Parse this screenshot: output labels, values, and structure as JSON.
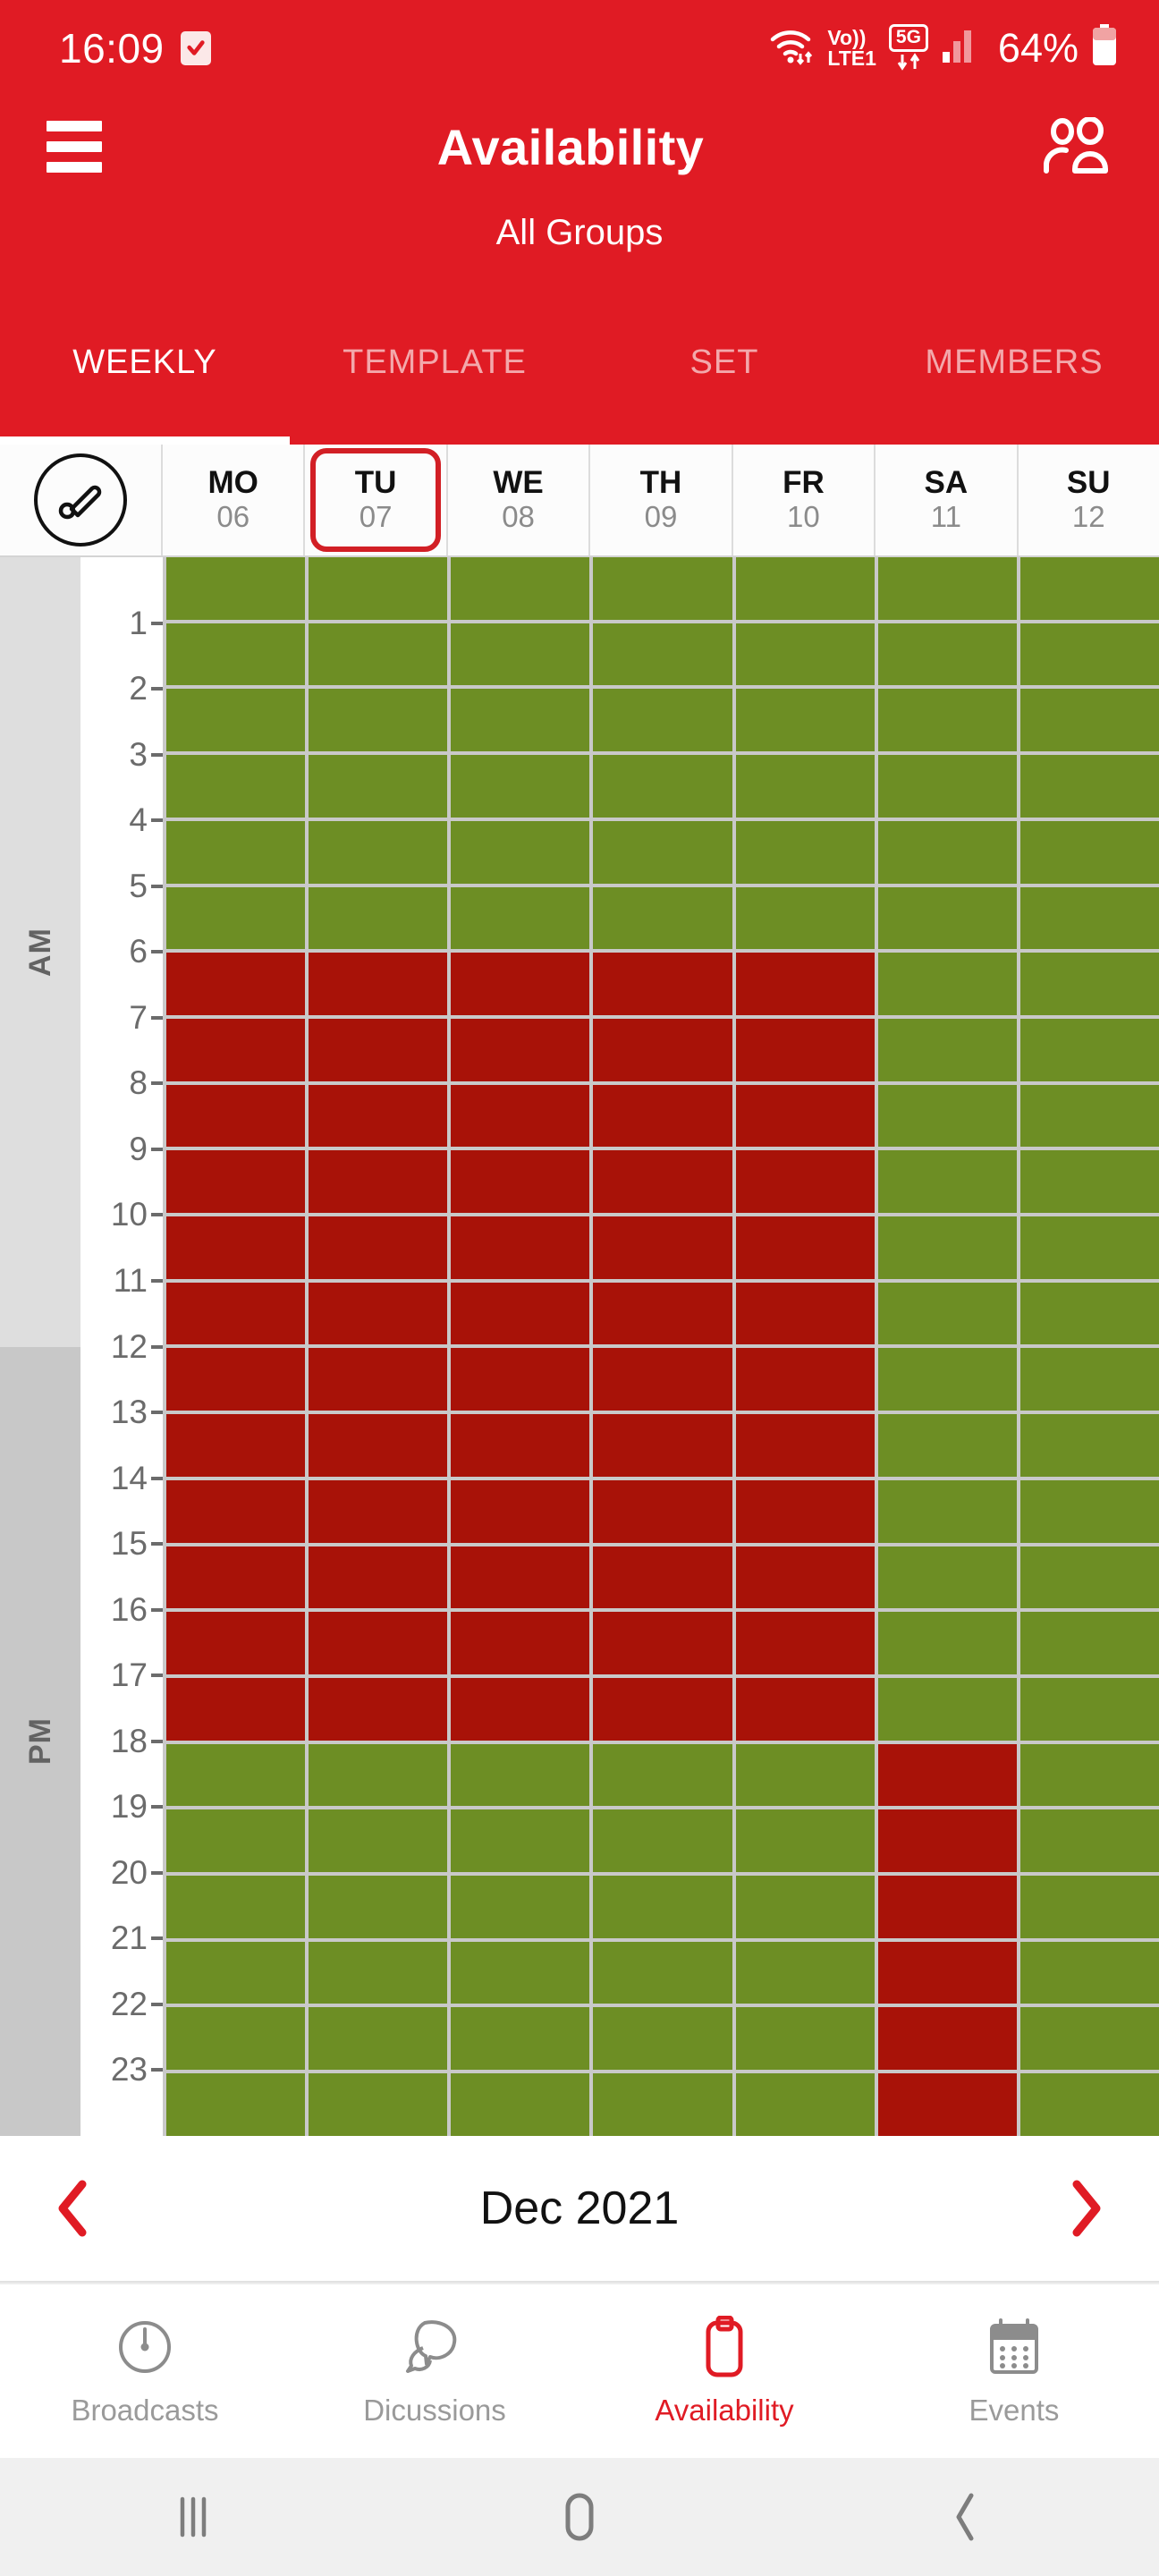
{
  "status_bar": {
    "time": "16:09",
    "checkbox_icon": "checkbox-checked-icon",
    "wifi_icon": "wifi-icon",
    "volte_line1": "Vo))",
    "volte_line2": "LTE1",
    "network_5g": "5G",
    "signal_icon": "signal-bars-icon",
    "battery_percent": "64%",
    "battery_icon": "battery-icon"
  },
  "header": {
    "menu_icon": "hamburger-menu-icon",
    "title": "Availability",
    "members_icon": "people-group-icon",
    "subtitle": "All Groups",
    "brand_red": "#E01B24"
  },
  "tabs": [
    {
      "label": "WEEKLY",
      "active": true
    },
    {
      "label": "TEMPLATE",
      "active": false
    },
    {
      "label": "SET",
      "active": false
    },
    {
      "label": "MEMBERS",
      "active": false
    }
  ],
  "day_header": {
    "brush_icon": "paintbrush-icon",
    "days": [
      {
        "dow": "MO",
        "num": "06",
        "selected": false
      },
      {
        "dow": "TU",
        "num": "07",
        "selected": true
      },
      {
        "dow": "WE",
        "num": "08",
        "selected": false
      },
      {
        "dow": "TH",
        "num": "09",
        "selected": false
      },
      {
        "dow": "FR",
        "num": "10",
        "selected": false
      },
      {
        "dow": "SA",
        "num": "11",
        "selected": false
      },
      {
        "dow": "SU",
        "num": "12",
        "selected": false
      }
    ]
  },
  "schedule": {
    "am_label": "AM",
    "pm_label": "PM",
    "hour_ticks": [
      "1",
      "2",
      "3",
      "4",
      "5",
      "6",
      "7",
      "8",
      "9",
      "10",
      "11",
      "12",
      "13",
      "14",
      "15",
      "16",
      "17",
      "18",
      "19",
      "20",
      "21",
      "22",
      "23"
    ],
    "legend": {
      "free_color": "#6D8E24",
      "busy_color": "#A81208"
    },
    "columns": [
      {
        "day": "MO",
        "hours": [
          "free",
          "free",
          "free",
          "free",
          "free",
          "free",
          "busy",
          "busy",
          "busy",
          "busy",
          "busy",
          "busy",
          "busy",
          "busy",
          "busy",
          "busy",
          "busy",
          "busy",
          "free",
          "free",
          "free",
          "free",
          "free",
          "free"
        ]
      },
      {
        "day": "TU",
        "hours": [
          "free",
          "free",
          "free",
          "free",
          "free",
          "free",
          "busy",
          "busy",
          "busy",
          "busy",
          "busy",
          "busy",
          "busy",
          "busy",
          "busy",
          "busy",
          "busy",
          "busy",
          "free",
          "free",
          "free",
          "free",
          "free",
          "free"
        ]
      },
      {
        "day": "WE",
        "hours": [
          "free",
          "free",
          "free",
          "free",
          "free",
          "free",
          "busy",
          "busy",
          "busy",
          "busy",
          "busy",
          "busy",
          "busy",
          "busy",
          "busy",
          "busy",
          "busy",
          "busy",
          "free",
          "free",
          "free",
          "free",
          "free",
          "free"
        ]
      },
      {
        "day": "TH",
        "hours": [
          "free",
          "free",
          "free",
          "free",
          "free",
          "free",
          "busy",
          "busy",
          "busy",
          "busy",
          "busy",
          "busy",
          "busy",
          "busy",
          "busy",
          "busy",
          "busy",
          "busy",
          "free",
          "free",
          "free",
          "free",
          "free",
          "free"
        ]
      },
      {
        "day": "FR",
        "hours": [
          "free",
          "free",
          "free",
          "free",
          "free",
          "free",
          "busy",
          "busy",
          "busy",
          "busy",
          "busy",
          "busy",
          "busy",
          "busy",
          "busy",
          "busy",
          "busy",
          "busy",
          "free",
          "free",
          "free",
          "free",
          "free",
          "free"
        ]
      },
      {
        "day": "SA",
        "hours": [
          "free",
          "free",
          "free",
          "free",
          "free",
          "free",
          "free",
          "free",
          "free",
          "free",
          "free",
          "free",
          "free",
          "free",
          "free",
          "free",
          "free",
          "free",
          "busy",
          "busy",
          "busy",
          "busy",
          "busy",
          "busy"
        ]
      },
      {
        "day": "SU",
        "hours": [
          "free",
          "free",
          "free",
          "free",
          "free",
          "free",
          "free",
          "free",
          "free",
          "free",
          "free",
          "free",
          "free",
          "free",
          "free",
          "free",
          "free",
          "free",
          "free",
          "free",
          "free",
          "free",
          "free",
          "free"
        ]
      }
    ]
  },
  "month_nav": {
    "prev_icon": "chevron-left-icon",
    "label": "Dec 2021",
    "next_icon": "chevron-right-icon",
    "arrow_color": "#E01B24"
  },
  "bottom_nav": [
    {
      "label": "Broadcasts",
      "icon": "speedometer-icon",
      "active": false
    },
    {
      "label": "Dicussions",
      "icon": "chat-bubbles-icon",
      "active": false
    },
    {
      "label": "Availability",
      "icon": "clipboard-icon",
      "active": true
    },
    {
      "label": "Events",
      "icon": "calendar-icon",
      "active": false
    }
  ],
  "android_nav": {
    "recents_icon": "recents-icon",
    "home_icon": "home-icon",
    "back_icon": "back-icon"
  }
}
